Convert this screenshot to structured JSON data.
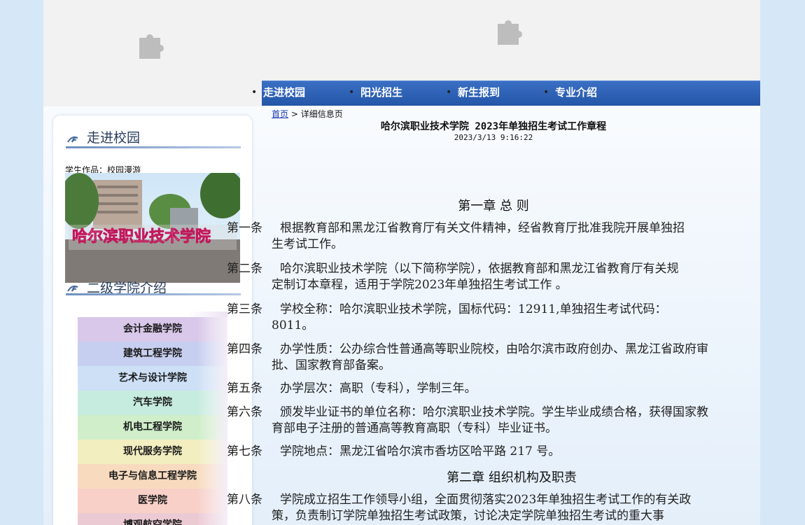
{
  "banner": {
    "plugin_icons": [
      "puzzle-plugin-icon",
      "puzzle-plugin-icon"
    ]
  },
  "nav": {
    "items": [
      {
        "label": "走进校园"
      },
      {
        "label": "阳光招生"
      },
      {
        "label": "新生报到"
      },
      {
        "label": "专业介绍"
      }
    ],
    "bullet": "•"
  },
  "sidebar": {
    "campus_title": "走进校园",
    "photo_caption": "学生作品：校园漫游",
    "photo_sign_text": "哈尔滨职业技术学院",
    "colleges_title": "二级学院介绍",
    "colleges": [
      "会计金融学院",
      "建筑工程学院",
      "艺术与设计学院",
      "汽车学院",
      "机电工程学院",
      "现代服务学院",
      "电子与信息工程学院",
      "医学院",
      "博观航空学院"
    ],
    "college_colors": [
      "#d9c8ea",
      "#c7cff0",
      "#cde0f6",
      "#c6ecdf",
      "#cfeec9",
      "#f2eec0",
      "#f8dbbf",
      "#f8d0c8",
      "#eccad4"
    ]
  },
  "breadcrumb": {
    "home": "首页",
    "separator": ">",
    "current": "详细信息页"
  },
  "article": {
    "title": "哈尔滨职业技术学院 2023年单独招生考试工作章程",
    "date": "2023/3/13 9:16:22",
    "chapter1": "第一章 总 则",
    "chapter2": "第二章 组织机构及职责",
    "articles": [
      {
        "label": "第一条",
        "line1": "根据教育部和黑龙江省教育厅有关文件精神，经省教育厅批准我院开展单独招",
        "line2": "生考试工作。"
      },
      {
        "label": "第二条",
        "line1": "哈尔滨职业技术学院（以下简称学院），依据教育部和黑龙江省教育厅有关规",
        "line2": "定制订本章程，适用于学院2023年单独招生考试工作 。"
      },
      {
        "label": "第三条",
        "line1": "学校全称：哈尔滨职业技术学院，国标代码：12911,单独招生考试代码：",
        "line2": "8011。"
      },
      {
        "label": "第四条",
        "line1": "办学性质：公办综合性普通高等职业院校，由哈尔滨市政府创办、黑龙江省政府审",
        "line2": "批、国家教育部备案。"
      },
      {
        "label": "第五条",
        "line1": "办学层次：高职（专科），学制三年。",
        "line2": ""
      },
      {
        "label": "第六条",
        "line1": "颁发毕业证书的单位名称：哈尔滨职业技术学院。学生毕业成绩合格，获得国家教",
        "line2": "育部电子注册的普通高等教育高职（专科）毕业证书。"
      },
      {
        "label": "第七条",
        "line1": "学院地点：黑龙江省哈尔滨市香坊区哈平路 217 号。",
        "line2": ""
      },
      {
        "label": "第八条",
        "line1": "学院成立招生工作领导小组，全面贯彻落实2023年单独招生考试工作的有关政",
        "line2": "策，负责制订学院单独招生考试政策，讨论决定学院单独招生考试的重大事"
      }
    ]
  }
}
